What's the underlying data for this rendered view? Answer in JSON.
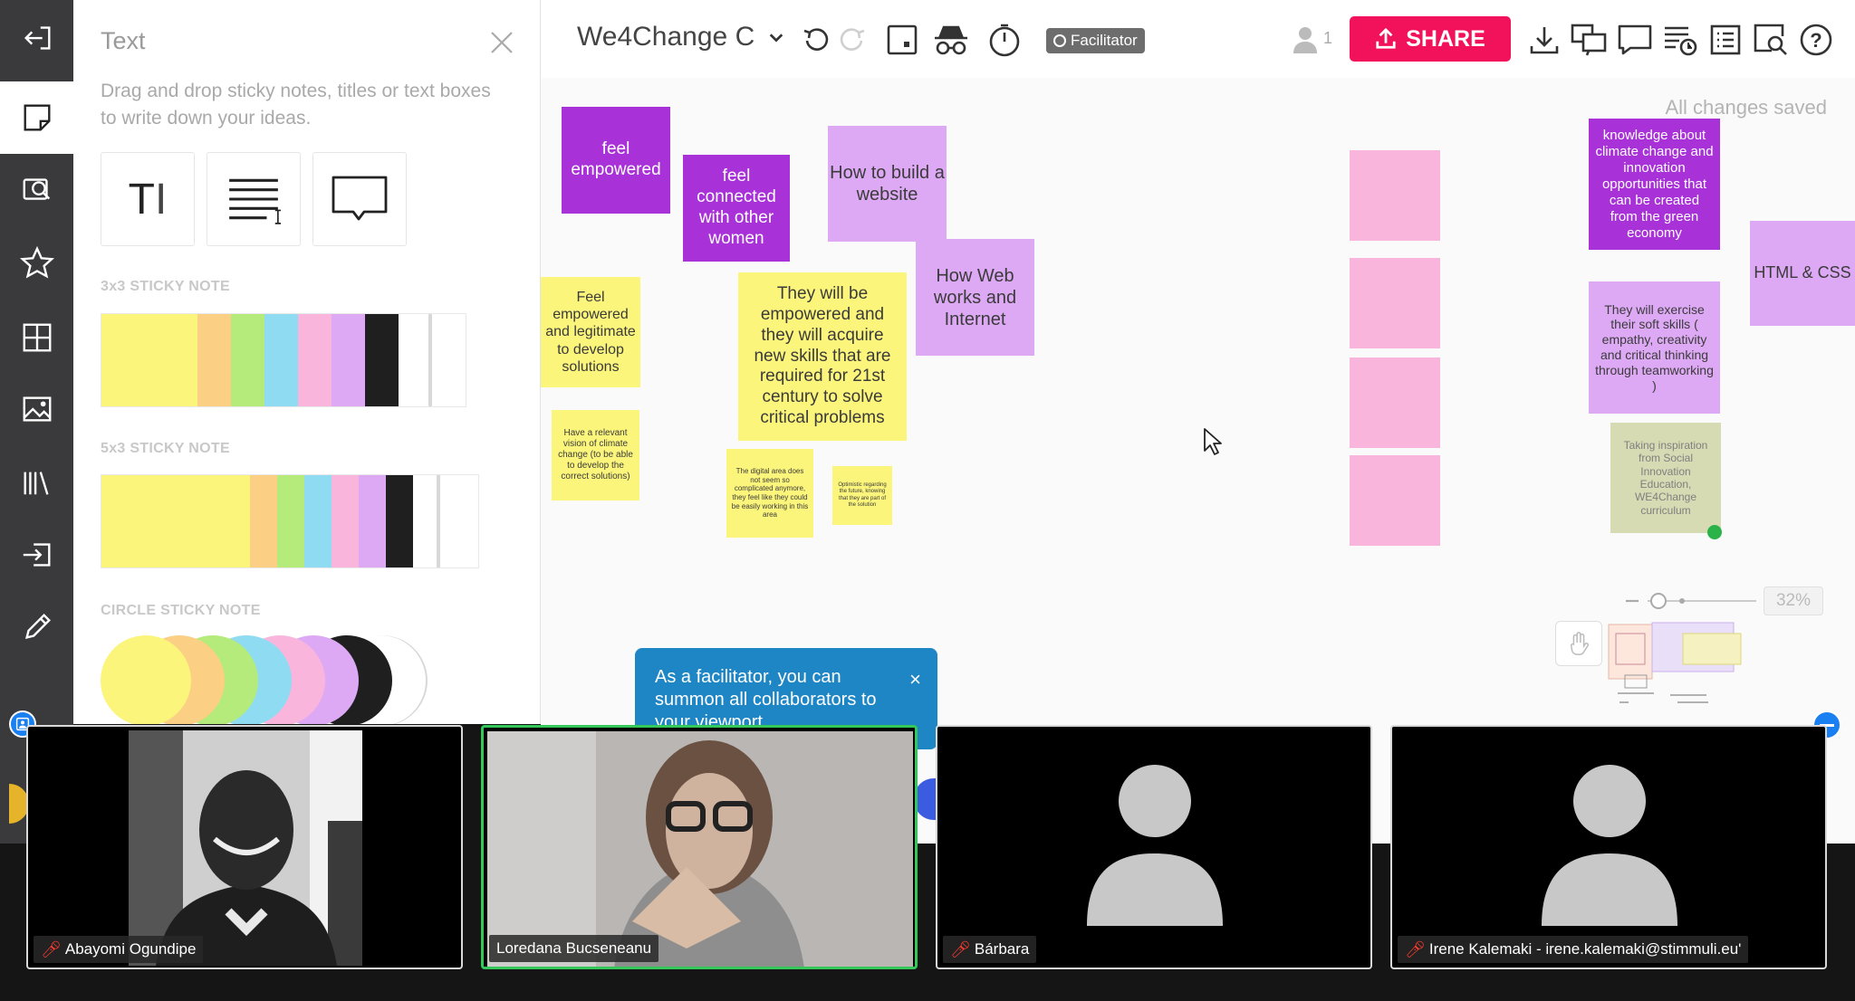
{
  "panel": {
    "title": "Text",
    "description": "Drag and drop sticky notes, titles or text boxes to write down your ideas.",
    "sections": [
      "3x3 STICKY NOTE",
      "5x3 STICKY NOTE",
      "CIRCLE STICKY NOTE"
    ],
    "swatch_colors": [
      "#fbf57b",
      "#fbcf84",
      "#b4eb7a",
      "#8fdcf2",
      "#f9b5dc",
      "#dda9f4",
      "#1f1f1f",
      "#ffffff"
    ]
  },
  "rail": {
    "icons": [
      "exit-icon",
      "sticky-note-icon",
      "search-board-icon",
      "star-icon",
      "grid-icon",
      "image-icon",
      "library-icon",
      "import-icon",
      "pencil-icon"
    ]
  },
  "topbar": {
    "board_title": "We4Change C",
    "facilitator_label": "Facilitator",
    "user_count": "1",
    "share_label": "SHARE",
    "brand_color": "#f2125c"
  },
  "canvas": {
    "saved_status": "All changes saved",
    "zoom_level": "32%",
    "notes": [
      {
        "text": "feel empowered",
        "color": "purple"
      },
      {
        "text": "feel connected with other women",
        "color": "purple"
      },
      {
        "text": "How to build a website",
        "color": "lilac"
      },
      {
        "text": "How Web works and Internet",
        "color": "lilac"
      },
      {
        "text": "Feel empowered and legitimate to develop solutions",
        "color": "yellow"
      },
      {
        "text": "They will be empowered and they will acquire new skills that are required for 21st century to solve critical problems",
        "color": "yellow"
      },
      {
        "text": "Have a relevant vision of climate change (to be able to develop the correct solutions)",
        "color": "yellow"
      },
      {
        "text": "The digital area does not seem so complicated anymore, they feel like they could be easily working in this area",
        "color": "yellow"
      },
      {
        "text": "Optimistic regarding the future, knowing that they are part of the solution",
        "color": "yellow"
      },
      {
        "text": "knowledge about climate change and innovation opportunities that can be created from the green economy",
        "color": "purple"
      },
      {
        "text": "HTML & CSS",
        "color": "lilac"
      },
      {
        "text": "They will exercise their soft skills ( empathy, creativity and critical thinking through teamworking )",
        "color": "lilac"
      },
      {
        "text": "Taking inspiration from Social Innovation Education, WE4Change curriculum",
        "color": "sage"
      }
    ]
  },
  "toast": {
    "message": "As a facilitator, you can summon all collaborators to your viewport",
    "close": "×"
  },
  "participants": [
    {
      "name": "Abayomi Ogundipe",
      "muted": true
    },
    {
      "name": "Loredana Bucseneanu",
      "muted": false
    },
    {
      "name": "Bárbara",
      "muted": true
    },
    {
      "name": "Irene Kalemaki - irene.kalemaki@stimmuli.eu'",
      "muted": true
    }
  ]
}
